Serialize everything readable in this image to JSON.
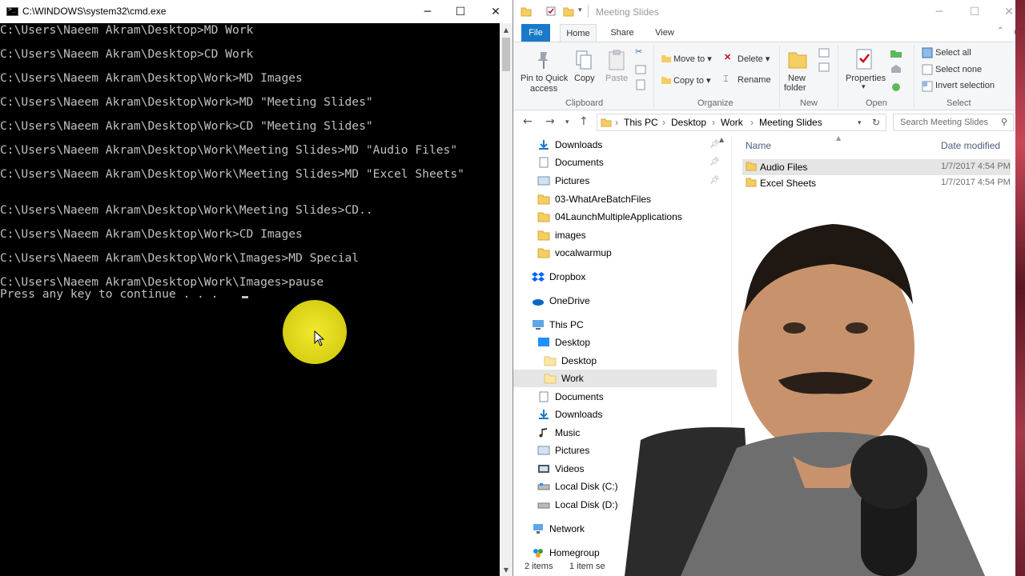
{
  "cmd": {
    "title": "C:\\WINDOWS\\system32\\cmd.exe",
    "lines": [
      "C:\\Users\\Naeem Akram\\Desktop>MD Work",
      "C:\\Users\\Naeem Akram\\Desktop>CD Work",
      "C:\\Users\\Naeem Akram\\Desktop\\Work>MD Images",
      "C:\\Users\\Naeem Akram\\Desktop\\Work>MD \"Meeting Slides\"",
      "C:\\Users\\Naeem Akram\\Desktop\\Work>CD \"Meeting Slides\"",
      "C:\\Users\\Naeem Akram\\Desktop\\Work\\Meeting Slides>MD \"Audio Files\"",
      "C:\\Users\\Naeem Akram\\Desktop\\Work\\Meeting Slides>MD \"Excel Sheets\"",
      "C:\\Users\\Naeem Akram\\Desktop\\Work\\Meeting Slides>CD..",
      "C:\\Users\\Naeem Akram\\Desktop\\Work>CD Images",
      "C:\\Users\\Naeem Akram\\Desktop\\Work\\Images>MD Special",
      "C:\\Users\\Naeem Akram\\Desktop\\Work\\Images>pause",
      "Press any key to continue . . ."
    ],
    "minimize": "─",
    "maximize": "☐",
    "close": "✕"
  },
  "explorer": {
    "title": "Meeting Slides",
    "tabs": {
      "file": "File",
      "home": "Home",
      "share": "Share",
      "view": "View"
    },
    "ribbon": {
      "pin": "Pin to Quick",
      "pin2": "access",
      "copy": "Copy",
      "paste": "Paste",
      "clipboard": "Clipboard",
      "move_to": "Move to",
      "copy_to": "Copy to",
      "delete": "Delete",
      "rename": "Rename",
      "organize": "Organize",
      "new_folder": "New",
      "new_folder2": "folder",
      "new": "New",
      "properties": "Properties",
      "open": "Open",
      "select_all": "Select all",
      "select_none": "Select none",
      "invert_selection": "Invert selection",
      "select": "Select"
    },
    "address": {
      "crumbs": [
        "This PC",
        "Desktop",
        "Work",
        "Meeting Slides"
      ],
      "search_placeholder": "Search Meeting Slides"
    },
    "nav": [
      "Downloads",
      "Documents",
      "Pictures",
      "03-WhatAreBatchFiles",
      "04LaunchMultipleApplications",
      "images",
      "vocalwarmup",
      "Dropbox",
      "OneDrive",
      "This PC",
      "Desktop",
      "Desktop",
      "Work",
      "Documents",
      "Downloads",
      "Music",
      "Pictures",
      "Videos",
      "Local Disk (C:)",
      "Local Disk (D:)",
      "Network",
      "Homegroup"
    ],
    "columns": {
      "name": "Name",
      "date": "Date modified"
    },
    "files": [
      {
        "name": "Audio Files",
        "date": "1/7/2017 4:54 PM"
      },
      {
        "name": "Excel Sheets",
        "date": "1/7/2017 4:54 PM"
      }
    ],
    "status": {
      "items": "2 items",
      "selected": "1 item se"
    }
  }
}
